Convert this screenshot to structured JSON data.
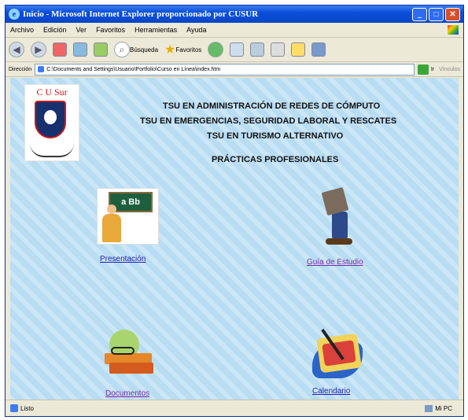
{
  "window": {
    "title": "Inicio - Microsoft Internet Explorer proporcionado por CUSUR"
  },
  "menu": [
    "Archivo",
    "Edición",
    "Ver",
    "Favoritos",
    "Herramientas",
    "Ayuda"
  ],
  "toolbar": {
    "search_label": "Búsqueda",
    "favorites_label": "Favoritos"
  },
  "address": {
    "label": "Dirección",
    "value": "C:\\Documents and Settings\\Usuario\\Portfolio\\Curso en Línea\\index.htm",
    "go_label": "Ir",
    "links_label": "Vínculos"
  },
  "logo": {
    "text": "C U Sur"
  },
  "headings": [
    "TSU EN ADMINISTRACIÓN DE REDES DE CÓMPUTO",
    "TSU EN  EMERGENCIAS, SEGURIDAD LABORAL Y RESCATES",
    "TSU EN TURISMO ALTERNATIVO",
    "PRÁCTICAS PROFESIONALES"
  ],
  "board_text": "a Bb",
  "links": {
    "presentacion": "Presentación",
    "guia": "Guía de Estudio",
    "documentos": "Documentos",
    "calendario": "Calendario"
  },
  "status": {
    "left": "Listo",
    "right": "Mi PC"
  }
}
